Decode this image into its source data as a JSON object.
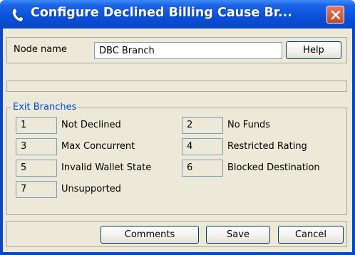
{
  "window": {
    "title": "Configure Declined Billing Cause Br...",
    "title_icon": "phone-handset-icon",
    "close_icon": "close-icon",
    "colors": {
      "titlebar": "#0a46c8",
      "client": "#ece9d8",
      "close": "#d4583a",
      "legend": "#0046d5"
    }
  },
  "node": {
    "label": "Node name",
    "value": "DBC Branch",
    "help_label": "Help"
  },
  "exit_branches": {
    "title": "Exit Branches",
    "items": [
      {
        "number": "1",
        "label": "Not Declined"
      },
      {
        "number": "2",
        "label": "No Funds"
      },
      {
        "number": "3",
        "label": "Max Concurrent"
      },
      {
        "number": "4",
        "label": "Restricted Rating"
      },
      {
        "number": "5",
        "label": "Invalid Wallet State"
      },
      {
        "number": "6",
        "label": "Blocked Destination"
      },
      {
        "number": "7",
        "label": "Unsupported"
      }
    ]
  },
  "buttons": {
    "comments": "Comments",
    "save": "Save",
    "cancel": "Cancel"
  }
}
